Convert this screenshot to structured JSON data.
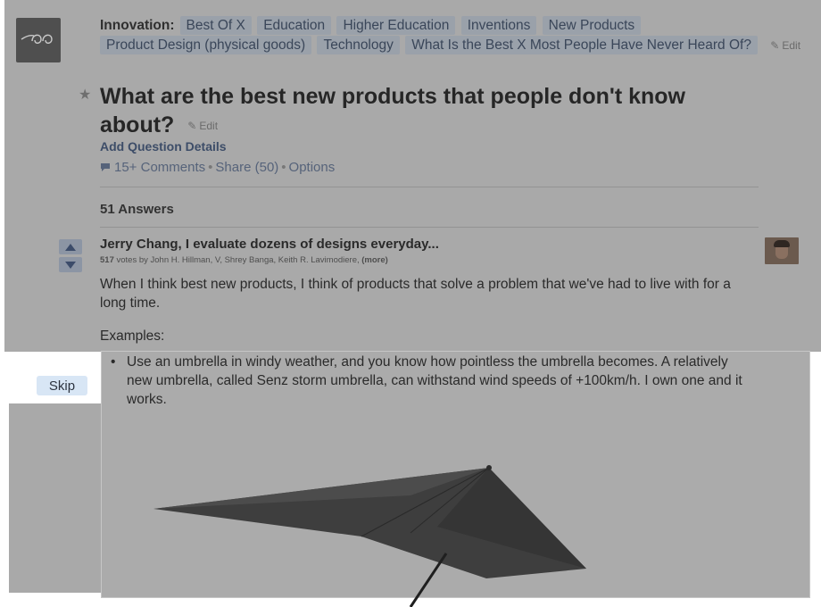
{
  "question": {
    "topics_lead": "Innovation:",
    "topics": [
      "Best Of X",
      "Education",
      "Higher Education",
      "Inventions",
      "New Products",
      "Product Design (physical goods)",
      "Technology",
      "What Is the Best X Most People Have Never Heard Of?"
    ],
    "edit_label": "Edit",
    "title": "What are the best new products that people don't know about?",
    "add_details": "Add Question Details",
    "comments": "15+ Comments",
    "share": "Share (50)",
    "options": "Options",
    "separator": "•"
  },
  "answers": {
    "count_label": "51 Answers"
  },
  "answer": {
    "author": "Jerry Chang, I evaluate dozens of designs everyday...",
    "votes_count": "517",
    "votes_text": "votes by John H. Hillman, V, Shrey Banga, Keith R. Lavimodiere,",
    "more": "(more)",
    "body": "When I think best new products, I think of products that solve a problem that we've had to live with for a long time.",
    "examples_label": "Examples:",
    "bullets": [
      "Use an umbrella in windy weather, and you know how pointless the umbrella becomes. A relatively new umbrella, called Senz storm umbrella,  can withstand wind speeds of +100km/h. I own one and it works."
    ]
  },
  "skip_label": "Skip",
  "icons": {
    "topic_logo": "topic-logo-icon",
    "star": "star-icon",
    "pencil": "pencil-icon",
    "comment": "comment-icon",
    "upvote": "upvote-arrow-icon",
    "downvote": "downvote-arrow-icon"
  },
  "colors": {
    "overlay": "#a9a9a9",
    "tag_bg": "#9aa1aa",
    "tag_text": "#3a4659",
    "link": "#3d4d68",
    "skip_bg": "#d8e6f5",
    "vote_bg": "#8c95a4"
  }
}
